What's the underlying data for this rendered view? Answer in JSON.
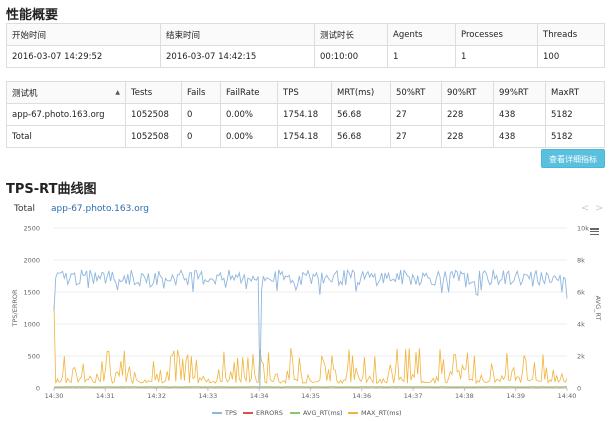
{
  "summary": {
    "title": "性能概要",
    "headers": [
      "开始时间",
      "结束时间",
      "测试时长",
      "Agents",
      "Processes",
      "Threads"
    ],
    "row": [
      "2016-03-07 14:29:52",
      "2016-03-07 14:42:15",
      "00:10:00",
      "1",
      "1",
      "100"
    ]
  },
  "stats": {
    "headers": [
      "测试机",
      "Tests",
      "Fails",
      "FailRate",
      "TPS",
      "MRT(ms)",
      "50%RT",
      "90%RT",
      "99%RT",
      "MaxRT"
    ],
    "rows": [
      [
        "app-67.photo.163.org",
        "1052508",
        "0",
        "0.00%",
        "1754.18",
        "56.68",
        "27",
        "228",
        "438",
        "5182"
      ],
      [
        "Total",
        "1052508",
        "0",
        "0.00%",
        "1754.18",
        "56.68",
        "27",
        "228",
        "438",
        "5182"
      ]
    ]
  },
  "detail_button": "查看详细指标",
  "chart_section": {
    "title": "TPS-RT曲线图",
    "tabs": [
      "Total",
      "app-67.photo.163.org"
    ],
    "pager_prev": "<",
    "pager_next": ">"
  },
  "colors": {
    "tps": "#8fb6de",
    "errors": "#d9534f",
    "avg_rt": "#8bc66b",
    "max_rt": "#f0b33c"
  },
  "chart_data": {
    "type": "line",
    "title": "",
    "xlabel": "",
    "ylabel_left": "TPS/ERROR",
    "ylabel_right": "AVG_RT",
    "x_ticks": [
      "14:30",
      "14:31",
      "14:32",
      "14:33",
      "14:34",
      "14:35",
      "14:36",
      "14:37",
      "14:38",
      "14:39",
      "14:40"
    ],
    "y_left_ticks": [
      "0",
      "500",
      "1000",
      "1500",
      "2000",
      "2500"
    ],
    "y_right_ticks": [
      "0",
      "2k",
      "4k",
      "6k",
      "8k",
      "10k"
    ],
    "ylim_left": [
      0,
      2500
    ],
    "ylim_right": [
      0,
      10000
    ],
    "grid": true,
    "legend_position": "bottom",
    "series": [
      {
        "name": "TPS",
        "axis": "left",
        "typical_range": [
          1600,
          1850
        ],
        "start": 1200,
        "dip": {
          "time": "14:34",
          "value": 0
        },
        "end": 1400
      },
      {
        "name": "ERRORS",
        "axis": "left",
        "values_constant": 0
      },
      {
        "name": "AVG_RT(ms)",
        "axis": "right",
        "values_constant": 60
      },
      {
        "name": "MAX_RT(ms)",
        "axis": "right",
        "baseline": 300,
        "typical_spikes": [
          1000,
          2500
        ],
        "start_peak": 5182
      }
    ]
  }
}
